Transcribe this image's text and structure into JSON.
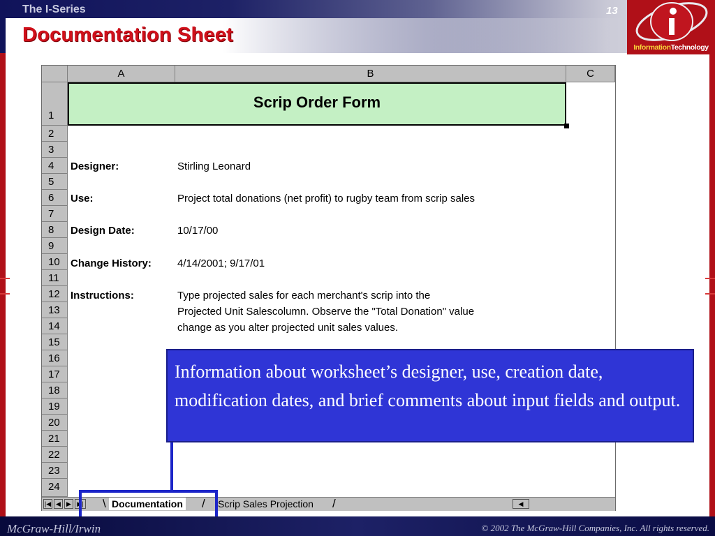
{
  "header": {
    "series": "The I-Series",
    "slide_number": "13",
    "title": "Documentation Sheet"
  },
  "logo": {
    "letter": "i",
    "text_a": "Information",
    "text_b": "Technology"
  },
  "spreadsheet": {
    "columns": [
      "A",
      "B",
      "C"
    ],
    "rows": [
      "1",
      "2",
      "3",
      "4",
      "5",
      "6",
      "7",
      "8",
      "9",
      "10",
      "11",
      "12",
      "13",
      "14",
      "15",
      "16",
      "17",
      "18",
      "19",
      "20",
      "21",
      "22",
      "23",
      "24"
    ],
    "banner_title": "Scrip Order Form",
    "designer_label": "Designer:",
    "designer_value": "Stirling Leonard",
    "use_label": "Use:",
    "use_value": "Project total donations (net profit) to rugby team from scrip sales",
    "design_date_label": "Design Date:",
    "design_date_value": "10/17/00",
    "change_history_label": "Change History:",
    "change_history_value": "4/14/2001; 9/17/01",
    "instructions_label": "Instructions:",
    "instructions_lines": [
      "Type projected sales for each merchant's scrip into the",
      "Projected Unit Salescolumn. Observe the \"Total Donation\" value",
      "change as you alter projected unit sales values."
    ],
    "tabs": [
      "Documentation",
      "Scrip Sales Projection"
    ]
  },
  "callout": {
    "text": "Information about worksheet’s designer, use, creation date, modification dates, and brief comments about input fields and output."
  },
  "footer": {
    "left": "McGraw-Hill/Irwin",
    "right": "© 2002  The McGraw-Hill Companies, Inc. All rights reserved."
  },
  "colors": {
    "title_red": "#d0101a",
    "banner_green": "#c4f0c4",
    "callout_blue": "#2f35d6",
    "navy": "#1d2166"
  }
}
